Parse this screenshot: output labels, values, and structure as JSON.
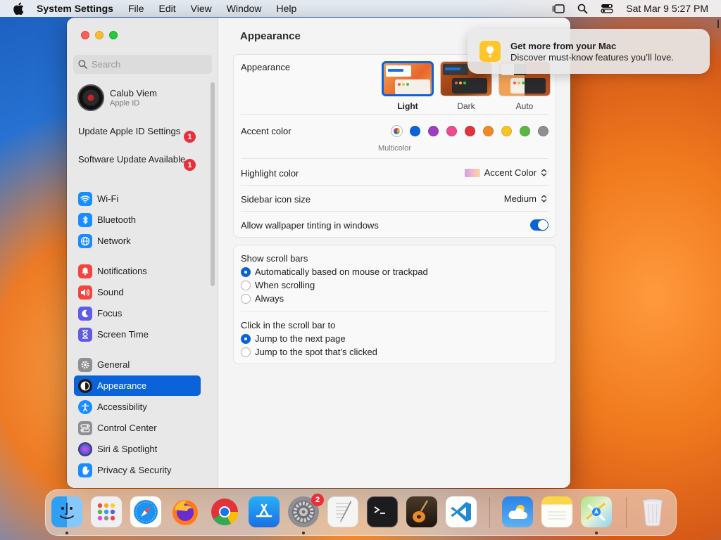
{
  "menubar": {
    "app_name": "System Settings",
    "items": [
      "File",
      "Edit",
      "View",
      "Window",
      "Help"
    ],
    "clock": "Sat Mar 9  5:27 PM"
  },
  "sidebar": {
    "search_placeholder": "Search",
    "profile": {
      "name": "Calub Viem",
      "subtitle": "Apple ID"
    },
    "notices": [
      {
        "label": "Update Apple ID Settings",
        "badge": "1"
      },
      {
        "label": "Software Update Available",
        "badge": "1"
      }
    ],
    "items": [
      {
        "label": "Wi-Fi",
        "icon": "wifi-icon",
        "color": "#1a8cff"
      },
      {
        "label": "Bluetooth",
        "icon": "bluetooth-icon",
        "color": "#1a8cff"
      },
      {
        "label": "Network",
        "icon": "globe-icon",
        "color": "#1a8cff"
      },
      {
        "label": "Notifications",
        "icon": "bell-icon",
        "color": "#f2453d"
      },
      {
        "label": "Sound",
        "icon": "speaker-icon",
        "color": "#f2453d"
      },
      {
        "label": "Focus",
        "icon": "moon-icon",
        "color": "#5e5ce6"
      },
      {
        "label": "Screen Time",
        "icon": "hourglass-icon",
        "color": "#5e5ce6"
      },
      {
        "label": "General",
        "icon": "gear-icon",
        "color": "#8e8e93"
      },
      {
        "label": "Appearance",
        "icon": "appearance-icon",
        "color": "#1c1c1e"
      },
      {
        "label": "Accessibility",
        "icon": "accessibility-icon",
        "color": "#1a8cff"
      },
      {
        "label": "Control Center",
        "icon": "control-center-icon",
        "color": "#8e8e93"
      },
      {
        "label": "Siri & Spotlight",
        "icon": "siri-icon",
        "color": "#222222"
      },
      {
        "label": "Privacy & Security",
        "icon": "hand-icon",
        "color": "#1a8cff"
      }
    ],
    "selected": "Appearance"
  },
  "main": {
    "title": "Appearance",
    "appearance": {
      "label": "Appearance",
      "options": [
        "Light",
        "Dark",
        "Auto"
      ],
      "selected": "Light"
    },
    "accent": {
      "label": "Accent color",
      "caption": "Multicolor",
      "colors": [
        "#0a63d9",
        "#9a3fbf",
        "#ea4c8d",
        "#e0333a",
        "#f08a24",
        "#f7c525",
        "#5bb645",
        "#8e8e93"
      ]
    },
    "highlight": {
      "label": "Highlight color",
      "value": "Accent Color"
    },
    "sidebar_icon_size": {
      "label": "Sidebar icon size",
      "value": "Medium"
    },
    "wallpaper_tinting": {
      "label": "Allow wallpaper tinting in windows",
      "on": true
    },
    "scroll_bars": {
      "label": "Show scroll bars",
      "options": [
        "Automatically based on mouse or trackpad",
        "When scrolling",
        "Always"
      ],
      "selected": "Automatically based on mouse or trackpad"
    },
    "click_scroll": {
      "label": "Click in the scroll bar to",
      "options": [
        "Jump to the next page",
        "Jump to the spot that’s clicked"
      ],
      "selected": "Jump to the next page"
    },
    "help_label": "?"
  },
  "notification": {
    "title": "Get more from your Mac",
    "body": "Discover must-know features you’ll love."
  },
  "dock": {
    "settings_badge": "2"
  }
}
